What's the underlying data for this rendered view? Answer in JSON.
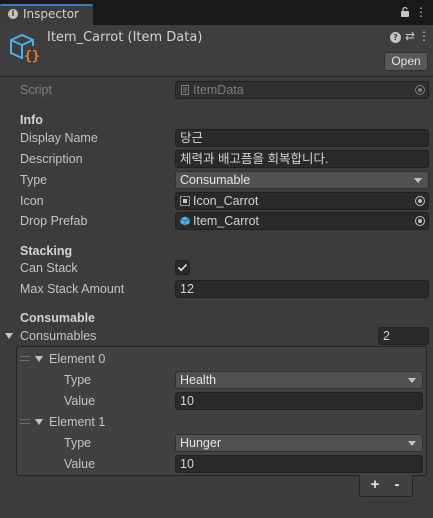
{
  "window": {
    "tab_label": "Inspector"
  },
  "header": {
    "title": "Item_Carrot (Item Data)",
    "open_label": "Open",
    "help_glyph": "?",
    "presets_glyph": "⇄",
    "menu_glyph": "⋮"
  },
  "script_field": {
    "label": "Script",
    "value": "ItemData"
  },
  "info": {
    "header": "Info",
    "display_name_label": "Display Name",
    "display_name_value": "당근",
    "description_label": "Description",
    "description_value": "체력과 배고픔을 회복합니다.",
    "type_label": "Type",
    "type_value": "Consumable",
    "icon_label": "Icon",
    "icon_value": "Icon_Carrot",
    "drop_prefab_label": "Drop Prefab",
    "drop_prefab_value": "Item_Carrot"
  },
  "stacking": {
    "header": "Stacking",
    "can_stack_label": "Can Stack",
    "can_stack_checked": true,
    "max_stack_label": "Max Stack Amount",
    "max_stack_value": "12"
  },
  "consumable": {
    "header": "Consumable",
    "list_label": "Consumables",
    "size": "2",
    "type_label": "Type",
    "value_label": "Value",
    "elements": [
      {
        "label": "Element 0",
        "type": "Health",
        "value": "10"
      },
      {
        "label": "Element 1",
        "type": "Hunger",
        "value": "10"
      }
    ],
    "add_label": "+",
    "remove_label": "-"
  },
  "colors": {
    "accent": "#3a79bb",
    "panel": "#3c3c3c",
    "field": "#2a2a2a",
    "dropdown": "#515151",
    "prefab_icon": "#4ab1e8",
    "asset_icon": "#4ab1e8",
    "braces": "#f07a30"
  }
}
